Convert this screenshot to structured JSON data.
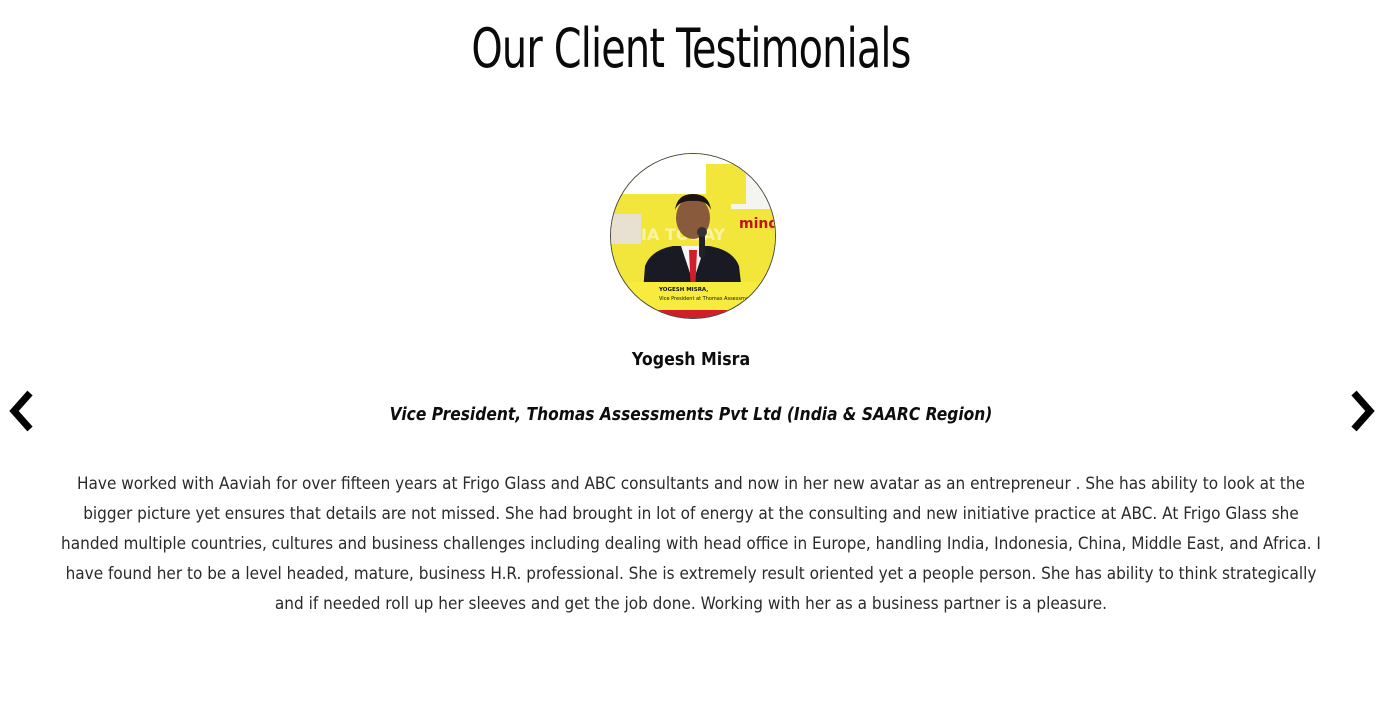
{
  "section": {
    "title": "Our Client Testimonials"
  },
  "testimonial": {
    "avatar_icon": "client-photo",
    "avatar_caption_name": "YOGESH MISRA,",
    "avatar_caption_role": "Vice President at Thomas Assessment",
    "avatar_background_text": "mind rocks",
    "avatar_watermark": "IA TODAY",
    "name": "Yogesh Misra",
    "role": "Vice President, Thomas Assessments Pvt Ltd (India & SAARC Region)",
    "quote": "Have worked with Aaviah for over fifteen years at Frigo Glass and ABC consultants and now in her new avatar as an entrepreneur . She has ability to look at the bigger picture yet ensures that details are not missed. She had brought in lot of energy at the consulting and new initiative practice at ABC. At Frigo Glass she handed multiple countries, cultures and business challenges including dealing with head office in Europe, handling India, Indonesia, China, Middle East, and Africa. I have found her to be a level headed, mature, business H.R. professional. She is extremely result oriented yet a people person. She has ability to think strategically and if needed roll up her sleeves and get the job done. Working with her as a business partner is a pleasure."
  },
  "navigation": {
    "prev_icon": "chevron-left-icon",
    "next_icon": "chevron-right-icon"
  },
  "colors": {
    "text": "#111111",
    "body_text": "#2b2b2b",
    "avatar_yellow": "#f2e63a",
    "avatar_red": "#d11f2a"
  }
}
